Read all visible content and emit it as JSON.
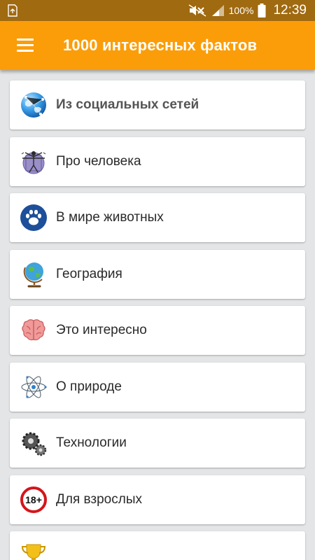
{
  "status_bar": {
    "battery": "100%",
    "time": "12:39",
    "icons": [
      "recycle-icon",
      "mute-icon",
      "signal-icon",
      "battery-icon"
    ]
  },
  "app_bar": {
    "title": "1000 интересных фактов",
    "menu_icon": "hamburger-menu-icon",
    "background": "#fb9d08"
  },
  "categories": [
    {
      "label": "Из социальных сетей",
      "icon": "globe-network-icon",
      "bold": true
    },
    {
      "label": "Про человека",
      "icon": "vitruvian-man-icon"
    },
    {
      "label": "В мире животных",
      "icon": "paw-icon"
    },
    {
      "label": "География",
      "icon": "desk-globe-icon"
    },
    {
      "label": "Это интересно",
      "icon": "brain-icon"
    },
    {
      "label": "О природе",
      "icon": "atom-icon"
    },
    {
      "label": "Технологии",
      "icon": "gears-icon"
    },
    {
      "label": "Для взрослых",
      "icon": "adult-18-plus-icon"
    },
    {
      "label": "",
      "icon": "trophy-icon"
    }
  ]
}
